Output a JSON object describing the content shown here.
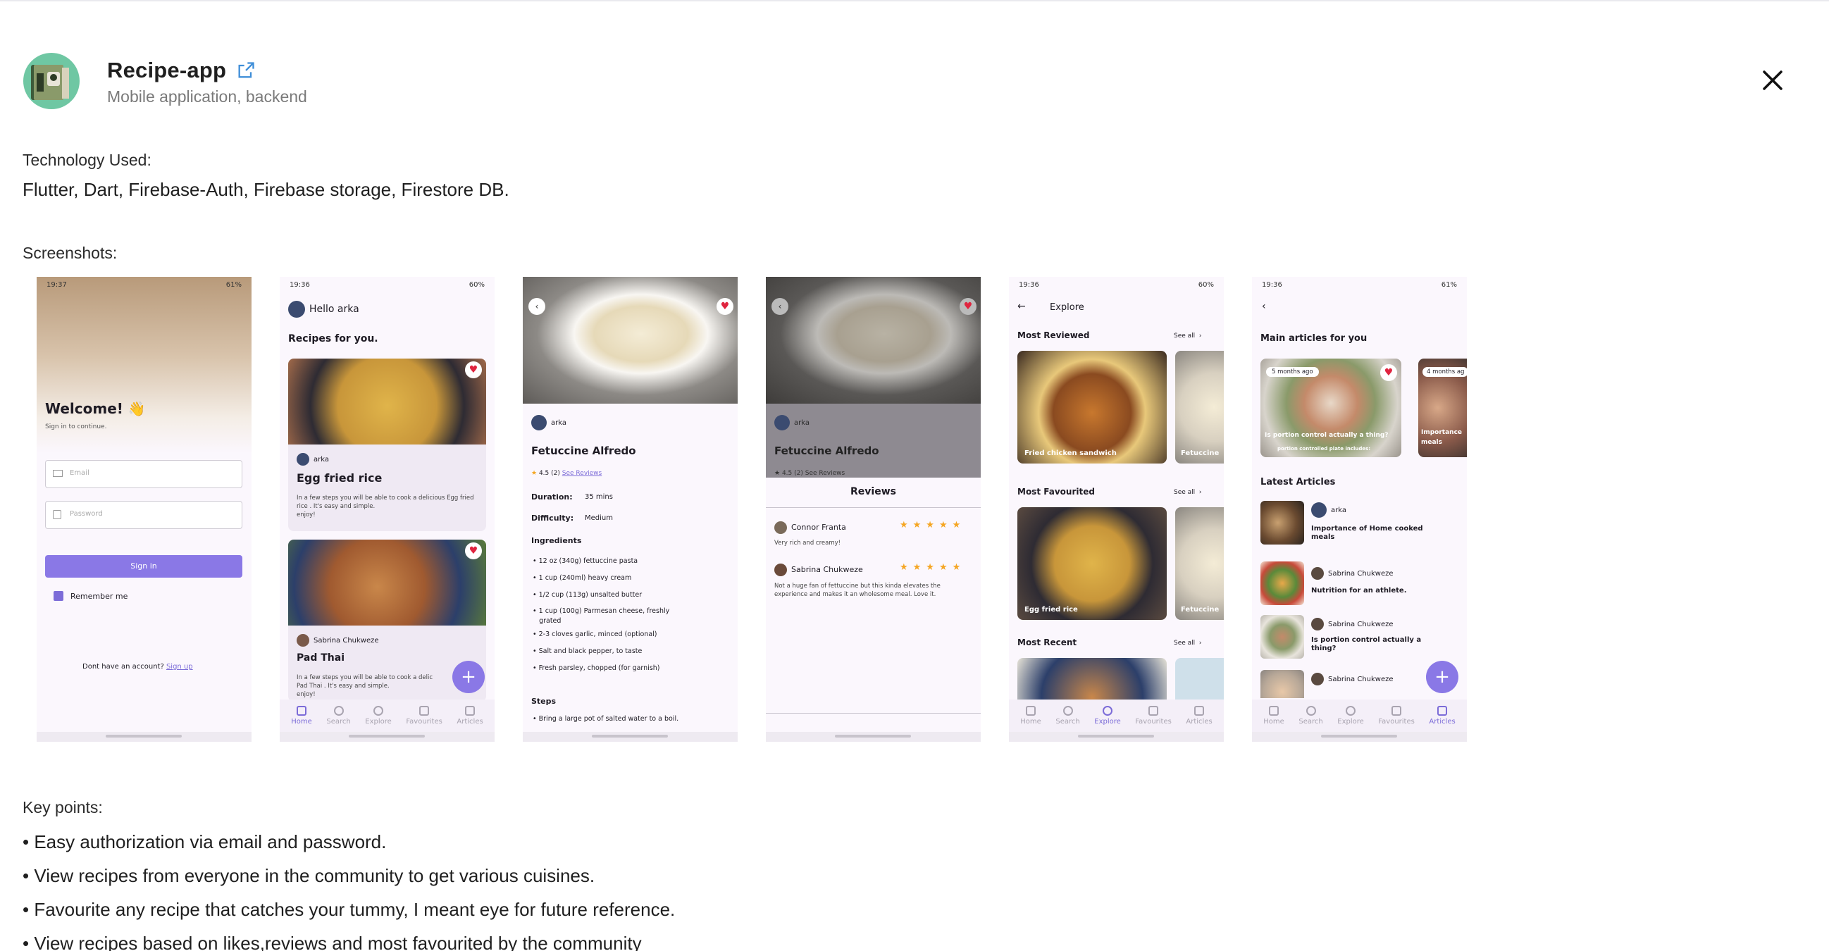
{
  "app": {
    "title": "Recipe-app",
    "subtitle": "Mobile application, backend",
    "icon": "recipe-book-icon",
    "accent": "#7c6cd8"
  },
  "tech": {
    "label": "Technology Used:",
    "value": "Flutter, Dart, Firebase-Auth, Firebase storage, Firestore DB."
  },
  "screenshots": {
    "label": "Screenshots:",
    "login": {
      "time": "19:37",
      "battery": "61%",
      "welcome": "Welcome! 👋",
      "subtitle": "Sign in to continue.",
      "email_placeholder": "Email",
      "password_placeholder": "Password",
      "sign_in": "Sign in",
      "remember": "Remember me",
      "no_account": "Dont have an account?",
      "sign_up": "Sign up"
    },
    "home": {
      "time": "19:36",
      "battery": "60%",
      "greeting": "Hello arka",
      "section": "Recipes for you.",
      "cards": [
        {
          "author": "arka",
          "title": "Egg fried rice",
          "desc": "In a few steps you will be able to cook a delicious Egg fried rice . It's easy and simple.",
          "desc2": "enjoy!"
        },
        {
          "author": "Sabrina Chukweze",
          "title": "Pad Thai",
          "desc": "In a few steps you will be able to cook a delic",
          "desc2": "Pad Thai . It's easy and simple.",
          "desc3": "enjoy!"
        }
      ]
    },
    "detail": {
      "author": "arka",
      "title": "Fetuccine Alfredo",
      "rating": "4.5",
      "rating_count": "(2)",
      "see_reviews": "See Reviews",
      "duration_label": "Duration:",
      "duration": "35 mins",
      "difficulty_label": "Difficulty:",
      "difficulty": "Medium",
      "ingredients_label": "Ingredients",
      "ingredients": [
        "12 oz (340g) fettuccine pasta",
        "1 cup (240ml) heavy cream",
        "1/2 cup (113g) unsalted butter",
        "1 cup (100g) Parmesan cheese, freshly",
        "grated",
        "2-3 cloves garlic, minced (optional)",
        "Salt and black pepper, to taste",
        "Fresh parsley, chopped (for garnish)"
      ],
      "steps_label": "Steps",
      "steps": [
        "Bring a large pot of salted water to a boil."
      ]
    },
    "reviews": {
      "author": "arka",
      "title": "Fetuccine Alfredo",
      "rating_row": "4.5 (2)",
      "see_reviews": "See Reviews",
      "header": "Reviews",
      "items": [
        {
          "name": "Connor Franta",
          "stars": 5,
          "text": "Very rich and creamy!"
        },
        {
          "name": "Sabrina Chukweze",
          "stars": 5,
          "text": "Not a huge fan of fettuccine but this kinda elevates the",
          "text2": "experience and makes it an wholesome meal. Love it."
        }
      ]
    },
    "explore": {
      "time": "19:36",
      "battery": "60%",
      "title": "Explore",
      "see_all": "See all",
      "most_reviewed": "Most Reviewed",
      "most_favourited": "Most Favourited",
      "most_recent": "Most Recent",
      "card_reviewed": "Fried chicken sandwich",
      "card_reviewed_2": "Fetuccine",
      "card_fav": "Egg fried rice",
      "card_fav_2": "Fetuccine"
    },
    "articles": {
      "time": "19:36",
      "battery": "61%",
      "main_title": "Main articles for you",
      "card1_badge": "5 months ago",
      "card1_title": "Is portion control actually a thing?",
      "card1_sub": "portion controlled plate includes:",
      "card2_badge": "4 months ag",
      "card2_title": "Importance",
      "card2_title2": "meals",
      "latest": "Latest Articles",
      "items": [
        {
          "author": "arka",
          "title": "Importance of Home cooked",
          "title2": "meals"
        },
        {
          "author": "Sabrina Chukweze",
          "title": "Nutrition for an athlete."
        },
        {
          "author": "Sabrina Chukweze",
          "title": "Is portion control actually a",
          "title2": "thing?"
        },
        {
          "author": "Sabrina Chukweze",
          "title": ""
        }
      ]
    },
    "nav": [
      "Home",
      "Search",
      "Explore",
      "Favourites",
      "Articles"
    ]
  },
  "key_points": {
    "label": "Key points:",
    "items": [
      "• Easy authorization via email and password.",
      "• View recipes from everyone in the community to get various cuisines.",
      "• Favourite any recipe that catches your tummy, I meant eye for future reference.",
      "• View recipes based on likes,reviews and most favourited by the community"
    ]
  }
}
